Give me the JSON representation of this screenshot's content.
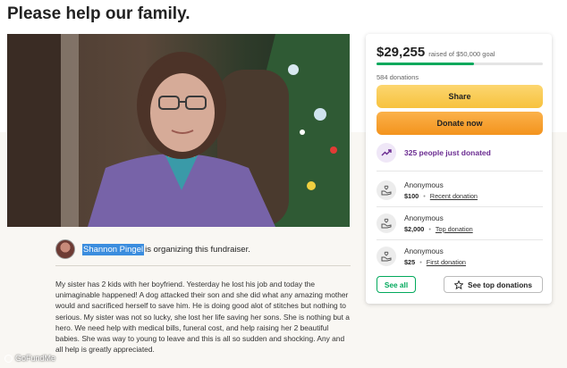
{
  "page": {
    "title": "Please help our family."
  },
  "organizer": {
    "name": "Shannon Pingel",
    "text": "is organizing this fundraiser."
  },
  "story": "My sister has 2 kids with her boyfriend. Yesterday he lost his job and today the unimaginable happened! A dog attacked their son and she did what any amazing mother would and sacrificed herself to save him. He is doing good alot of stitches but nothing to serious. My sister was not so lucky, she lost her life saving her sons. She is nothing but a hero. We need help with medical bills, funeral cost, and help raising her 2 beautiful babies. She was way to young to leave and this is all so sudden and shocking. Any and all help is greatly appreciated.",
  "card": {
    "raised": "$29,255",
    "goal_text": "raised of $50,000 goal",
    "progress_fraction": 0.585,
    "donations_count": "584 donations",
    "share_label": "Share",
    "donate_label": "Donate now",
    "just_donated": "325 people just donated",
    "donors": [
      {
        "name": "Anonymous",
        "amount": "$100",
        "tag": "Recent donation"
      },
      {
        "name": "Anonymous",
        "amount": "$2,000",
        "tag": "Top donation"
      },
      {
        "name": "Anonymous",
        "amount": "$25",
        "tag": "First donation"
      }
    ],
    "see_all_label": "See all",
    "see_top_label": "See top donations"
  },
  "watermark": "GoFundMe",
  "colors": {
    "accent_green": "#02a95c",
    "share_yellow": "#f7c23e",
    "donate_orange": "#f3931d",
    "purple": "#6b2c91"
  },
  "icons": {
    "trend": "trending-up-icon",
    "donor": "hand-heart-icon",
    "star": "star-icon"
  }
}
